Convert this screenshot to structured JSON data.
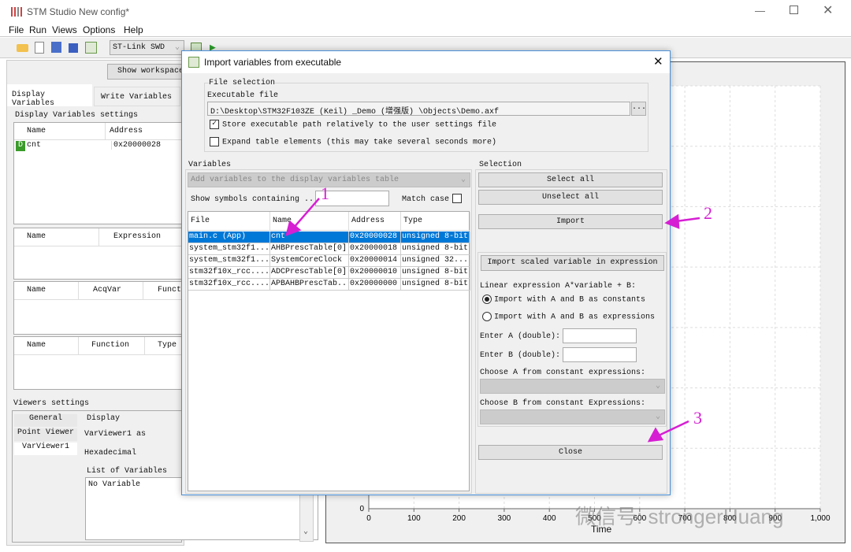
{
  "window": {
    "title": "STM Studio New config*",
    "menu": [
      "File",
      "Run",
      "Views",
      "Options",
      "Help"
    ],
    "connection": "ST-Link SWD",
    "show_workspace": "Show workspace"
  },
  "left": {
    "tabs": [
      "Display Variables",
      "Write Variables"
    ],
    "settings_title": "Display Variables settings",
    "var_table": {
      "headers": [
        "Name",
        "Address"
      ],
      "rows": [
        {
          "badge": "D",
          "name": "cnt",
          "address": "0x20000028"
        }
      ]
    },
    "expr_table": {
      "headers": [
        "Name",
        "Expression"
      ]
    },
    "acq_table": {
      "headers": [
        "Name",
        "AcqVar",
        "Funct:"
      ]
    },
    "func_table": {
      "headers": [
        "Name",
        "Function",
        "Type"
      ]
    },
    "viewers": {
      "title": "Viewers settings",
      "tabs": [
        "General",
        "Point Viewer",
        "VarViewer1"
      ],
      "display_label": "Display",
      "as_text": "VarViewer1 as",
      "format": "Hexadecimal",
      "list_label": "List of Variables",
      "list_value": "No Variable"
    }
  },
  "chart_data": {
    "type": "line",
    "xlabel": "Time",
    "x_ticks": [
      "0",
      "100",
      "200",
      "300",
      "400",
      "500",
      "600",
      "700",
      "800",
      "900",
      "1,000"
    ],
    "y_ticks": [
      "0"
    ],
    "xlim": [
      0,
      1000
    ],
    "grid": true,
    "series": []
  },
  "dialog": {
    "title": "Import variables from executable",
    "file_selection": "File selection",
    "exe_label": "Executable file",
    "exe_path": "D:\\Desktop\\STM32F103ZE (Keil) _Demo (增强版) \\Objects\\Demo.axf",
    "browse": "...",
    "store_rel": {
      "label": "Store executable path relatively to the user settings file",
      "checked": true
    },
    "expand": {
      "label": "Expand table elements (this may take several seconds more)",
      "checked": false
    },
    "variables_label": "Variables",
    "add_combo": "Add variables to the display variables table",
    "show_symbols": "Show symbols containing ...",
    "filter": "",
    "match_case": "Match case",
    "table": {
      "headers": [
        "File",
        "Name",
        "Address",
        "Type"
      ],
      "rows": [
        [
          "main.c (App)",
          "cnt",
          "0x20000028",
          "unsigned 8-bit"
        ],
        [
          "system_stm32f1...",
          "AHBPrescTable[0]",
          "0x20000018",
          "unsigned 8-bit"
        ],
        [
          "system_stm32f1...",
          "SystemCoreClock",
          "0x20000014",
          "unsigned 32..."
        ],
        [
          "stm32f10x_rcc....",
          "ADCPrescTable[0]",
          "0x20000010",
          "unsigned 8-bit"
        ],
        [
          "stm32f10x_rcc....",
          "APBAHBPrescTab...",
          "0x20000000",
          "unsigned 8-bit"
        ]
      ]
    },
    "selection_label": "Selection",
    "select_all": "Select all",
    "unselect_all": "Unselect all",
    "import": "Import",
    "import_scaled": "Import scaled variable in expression",
    "linear": "Linear expression A*variable + B:",
    "radio_const": "Import with A and B as constants",
    "radio_expr": "Import with A and B as expressions",
    "enter_a": "Enter A (double):",
    "enter_b": "Enter B (double):",
    "choose_a": "Choose A from constant expressions:",
    "choose_b": "Choose B from constant Expressions:",
    "close": "Close"
  },
  "annotations": [
    "1",
    "2",
    "3"
  ],
  "watermark": "微信号: strongerHuang",
  "colors": {
    "selection": "#0078d7",
    "annotation": "#d61fd3",
    "dialog_border": "#4a90d9"
  }
}
